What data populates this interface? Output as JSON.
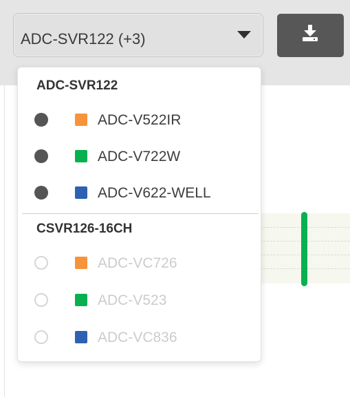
{
  "device_select": {
    "value": "ADC-SVR122 (+3)"
  },
  "colors": {
    "orange": "#f7943b",
    "green": "#09b050",
    "blue": "#2f61b3",
    "event_bar": "#09b050"
  },
  "icons": {
    "download_button": "download-icon",
    "select_caret": "chevron-down-icon"
  },
  "dropdown": {
    "groups": [
      {
        "header": "ADC-SVR122",
        "items": [
          {
            "label": "ADC-V522IR",
            "selected": true,
            "color": "orange"
          },
          {
            "label": "ADC-V722W",
            "selected": true,
            "color": "green"
          },
          {
            "label": "ADC-V622-WELL",
            "selected": true,
            "color": "blue"
          }
        ]
      },
      {
        "header": "CSVR126-16CH",
        "items": [
          {
            "label": "ADC-VC726",
            "selected": false,
            "color": "orange"
          },
          {
            "label": "ADC-V523",
            "selected": false,
            "color": "green"
          },
          {
            "label": "ADC-VC836",
            "selected": false,
            "color": "blue"
          }
        ]
      }
    ]
  }
}
